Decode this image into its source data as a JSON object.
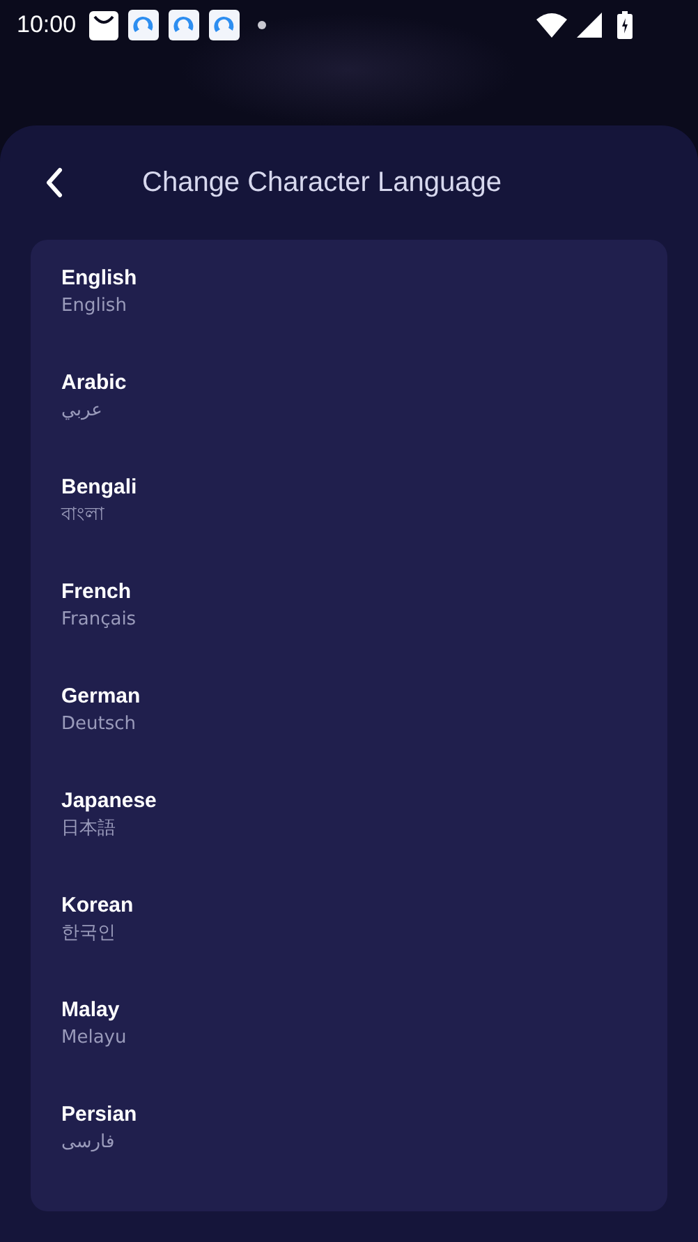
{
  "status_bar": {
    "time": "10:00"
  },
  "header": {
    "title": "Change Character Language"
  },
  "languages": [
    {
      "name": "English",
      "native": "English"
    },
    {
      "name": "Arabic",
      "native": "عربي"
    },
    {
      "name": "Bengali",
      "native": "বাংলা"
    },
    {
      "name": "French",
      "native": "Français"
    },
    {
      "name": "German",
      "native": "Deutsch"
    },
    {
      "name": "Japanese",
      "native": "日本語"
    },
    {
      "name": "Korean",
      "native": "한국인"
    },
    {
      "name": "Malay",
      "native": "Melayu"
    },
    {
      "name": "Persian",
      "native": "فارسی"
    }
  ]
}
